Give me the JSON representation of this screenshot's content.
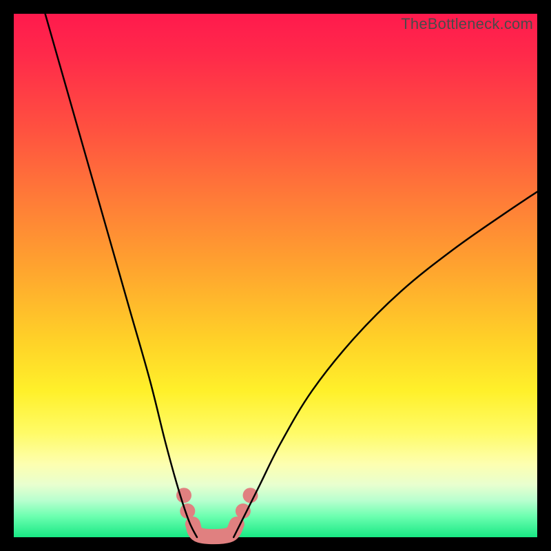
{
  "watermark": "TheBottleneck.com",
  "chart_data": {
    "type": "line",
    "title": "",
    "xlabel": "",
    "ylabel": "",
    "xlim": [
      0,
      100
    ],
    "ylim": [
      0,
      100
    ],
    "series": [
      {
        "name": "left-curve",
        "x": [
          6,
          10,
          14,
          18,
          22,
          26,
          29,
          31.5,
          33.5,
          35
        ],
        "y": [
          100,
          86,
          72,
          58,
          44,
          30,
          18,
          9,
          3,
          0
        ]
      },
      {
        "name": "right-curve",
        "x": [
          42,
          44,
          47,
          51,
          57,
          65,
          74,
          84,
          94,
          100
        ],
        "y": [
          0,
          4,
          10,
          18,
          28,
          38,
          47,
          55,
          62,
          66
        ]
      }
    ],
    "markers": [
      {
        "name": "left-blob-upper",
        "x": 32.5,
        "y": 8
      },
      {
        "name": "left-blob-lower",
        "x": 33.2,
        "y": 5
      },
      {
        "name": "right-blob-lower",
        "x": 43.8,
        "y": 5
      },
      {
        "name": "right-blob-upper",
        "x": 45.2,
        "y": 8
      }
    ],
    "valley_segment": {
      "name": "valley-sausage",
      "points": [
        {
          "x": 34.2,
          "y": 2.5
        },
        {
          "x": 35.5,
          "y": 0.4
        },
        {
          "x": 41.0,
          "y": 0.4
        },
        {
          "x": 42.6,
          "y": 2.5
        }
      ]
    },
    "background_gradient": {
      "top": "#ff1a4d",
      "mid": "#ffd028",
      "bottom": "#18e884"
    }
  }
}
